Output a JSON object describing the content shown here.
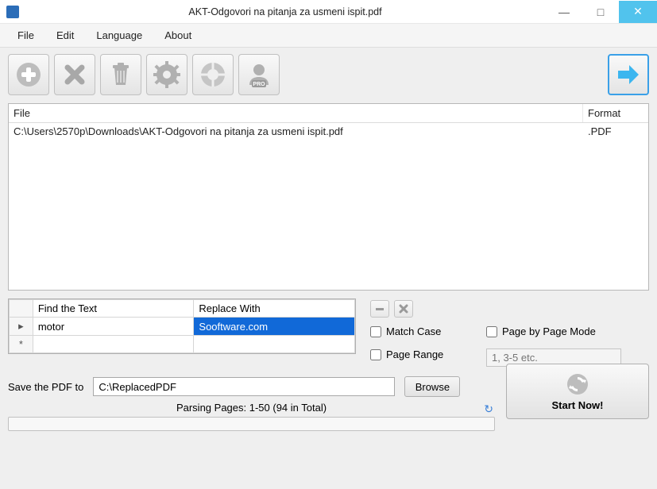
{
  "window": {
    "title": "AKT-Odgovori na pitanja za usmeni ispit.pdf"
  },
  "menu": {
    "file": "File",
    "edit": "Edit",
    "language": "Language",
    "about": "About"
  },
  "toolbar": {
    "add": "add",
    "remove": "remove",
    "delete": "delete",
    "settings": "settings",
    "help": "help",
    "pro": "PRO",
    "next": "next"
  },
  "file_table": {
    "headers": {
      "file": "File",
      "format": "Format"
    },
    "rows": [
      {
        "file": "C:\\Users\\2570p\\Downloads\\AKT-Odgovori na pitanja za usmeni ispit.pdf",
        "format": ".PDF"
      }
    ]
  },
  "replace_table": {
    "headers": {
      "find": "Find the Text",
      "replace": "Replace With"
    },
    "rows": [
      {
        "marker": "▸",
        "find": "motor",
        "replace": "Sooftware.com"
      },
      {
        "marker": "*",
        "find": "",
        "replace": ""
      }
    ]
  },
  "options": {
    "match_case": "Match Case",
    "page_range": "Page Range",
    "page_by_page": "Page by Page Mode",
    "range_placeholder": "1, 3-5 etc."
  },
  "save": {
    "label": "Save the PDF to",
    "path": "C:\\ReplacedPDF",
    "browse": "Browse"
  },
  "status": {
    "parsing": "Parsing Pages: 1-50 (94 in Total)"
  },
  "start": {
    "label": "Start Now!"
  }
}
